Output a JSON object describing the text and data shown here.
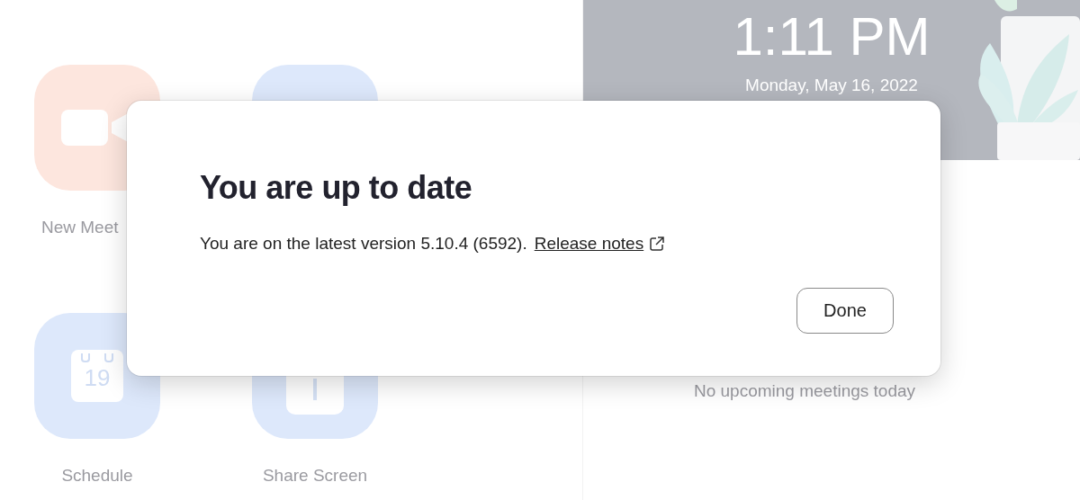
{
  "home": {
    "actions": [
      {
        "kind": "video",
        "label": "New Meet"
      },
      {
        "kind": "join"
      },
      {
        "kind": "calendar",
        "label": "Schedule",
        "day": "19"
      },
      {
        "kind": "share",
        "label": "Share Screen"
      }
    ]
  },
  "clock": {
    "time": "1:11 PM",
    "date": "Monday, May 16, 2022"
  },
  "meetings": {
    "empty_message": "No upcoming meetings today"
  },
  "dialog": {
    "title": "You are up to date",
    "message": "You are on the latest version 5.10.4 (6592).",
    "link": "Release notes",
    "buttons": [
      "Done"
    ]
  }
}
